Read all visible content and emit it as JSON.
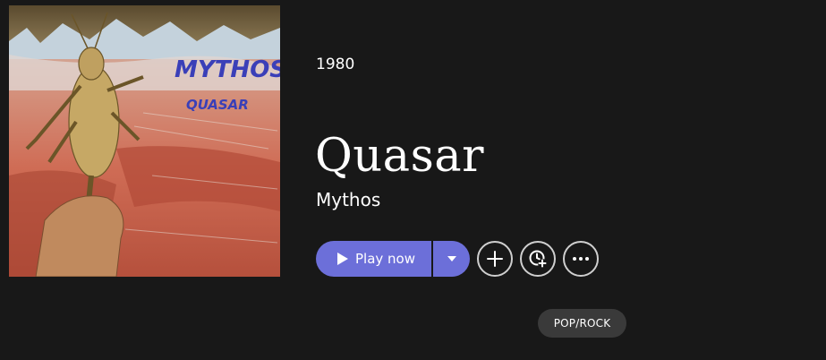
{
  "album": {
    "cover_title": "MYTHOS",
    "cover_subtitle": "QUASAR",
    "year": "1980",
    "title": "Quasar",
    "artist": "Mythos"
  },
  "actions": {
    "play_label": "Play now",
    "play_icon": "play-icon",
    "dropdown_icon": "caret-down-icon",
    "add_icon": "plus-icon",
    "queue_icon": "clock-plus-icon",
    "more_icon": "ellipsis-icon"
  },
  "genre": "POP/ROCK",
  "colors": {
    "background": "#181818",
    "accent": "#6c6fd9",
    "genre_pill": "#3a3a3a"
  }
}
